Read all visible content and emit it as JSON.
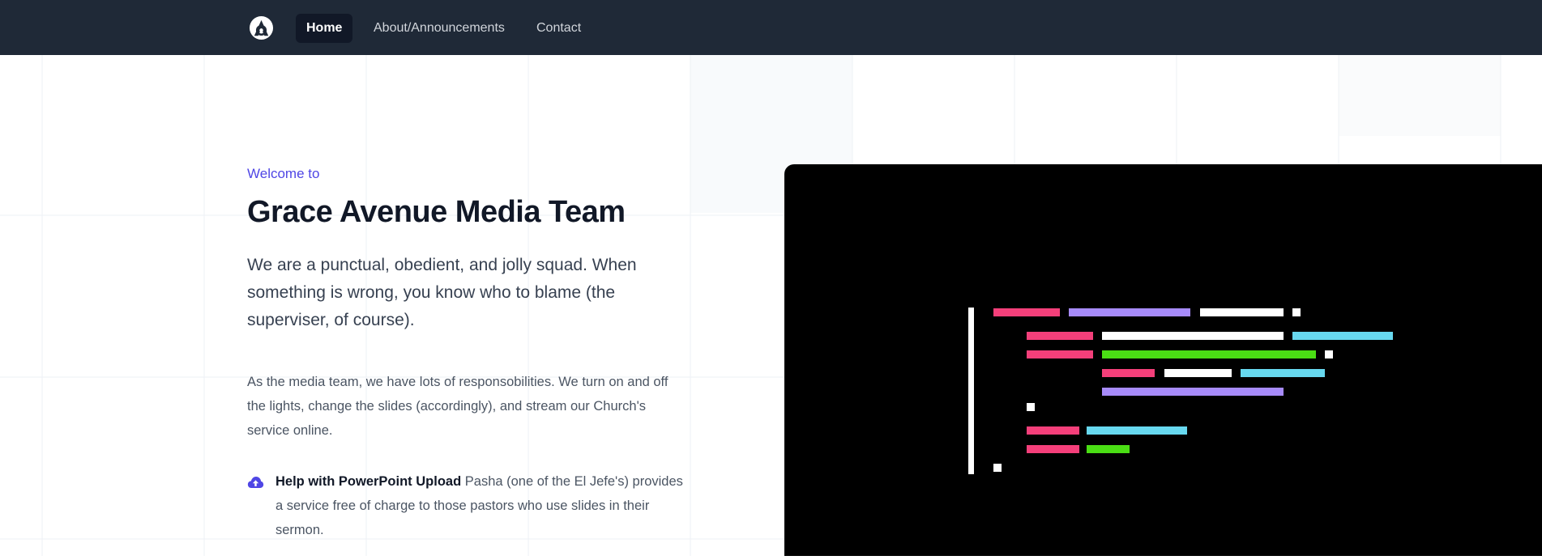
{
  "nav": {
    "logo_icon": "grace-avenue-logo",
    "items": [
      {
        "label": "Home",
        "active": true
      },
      {
        "label": "About/Announcements",
        "active": false
      },
      {
        "label": "Contact",
        "active": false
      }
    ]
  },
  "hero": {
    "eyebrow": "Welcome to",
    "title": "Grace Avenue Media Team",
    "lead": "We are a punctual, obedient, and jolly squad. When something is wrong, you know who to blame (the superviser, of course).",
    "body": "As the media team, we have lots of responsobilities. We turn on and off the lights, change the slides (accordingly), and stream our Church's service online.",
    "feature": {
      "icon": "cloud-upload-icon",
      "title": "Help with PowerPoint Upload",
      "text": " Pasha (one of the El Jefe's) provides a service free of charge to those pastors who use slides in their sermon."
    }
  },
  "colors": {
    "navbar": "#1f2937",
    "accent": "#4f46e5",
    "code_pink": "#f43f7a",
    "code_purple": "#a78bfa",
    "code_white": "#ffffff",
    "code_cyan": "#67d8ef",
    "code_green": "#4ade14"
  }
}
